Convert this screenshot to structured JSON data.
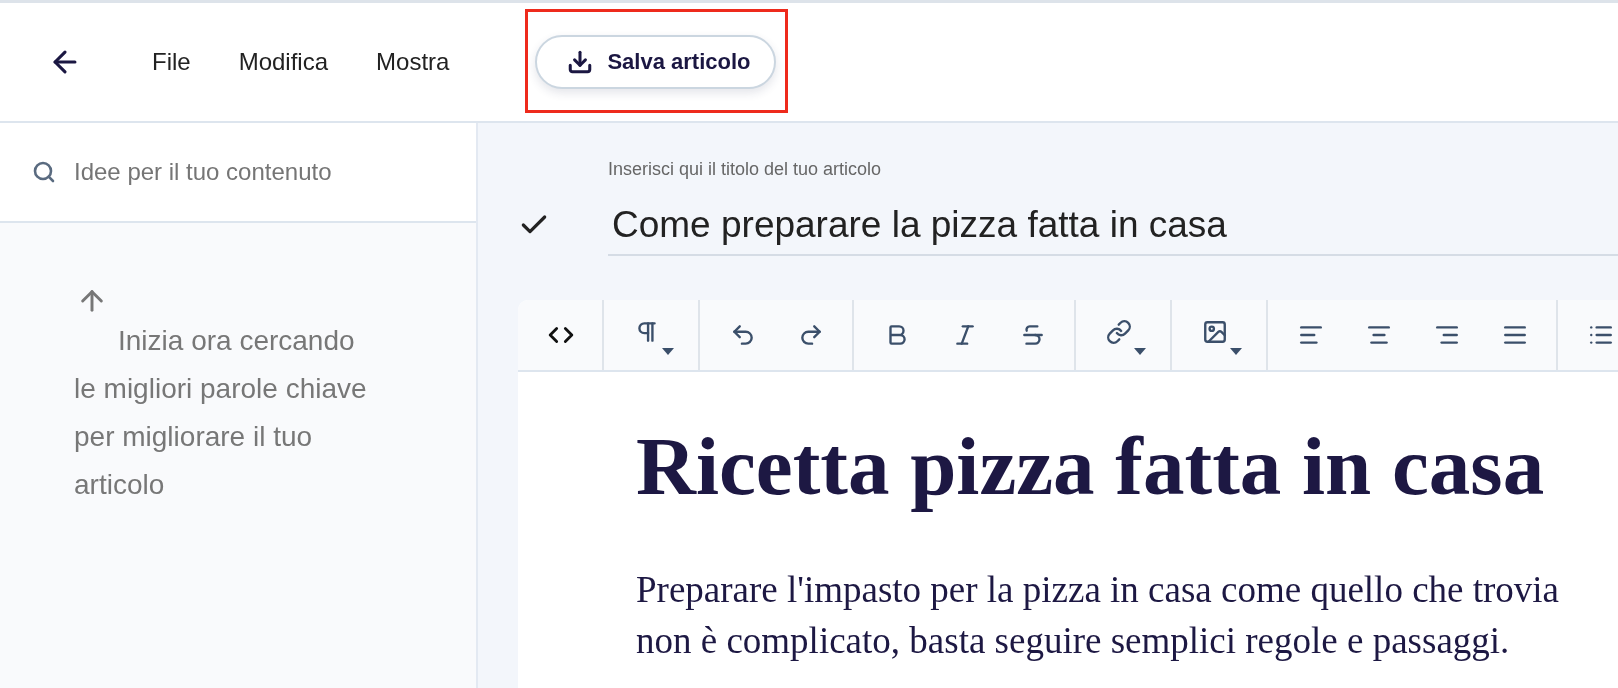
{
  "menu": [
    {
      "label": "File"
    },
    {
      "label": "Modifica"
    },
    {
      "label": "Mostra"
    }
  ],
  "save_button": {
    "label": "Salva articolo",
    "highlighted": true
  },
  "sidebar": {
    "search": {
      "placeholder": "Idee per il tuo contenuto"
    },
    "hint": "Inizia ora cercando le migliori parole chiave per migliorare il tuo articolo"
  },
  "title_field": {
    "label": "Inserisci qui il titolo del tuo articolo",
    "value": "Come preparare la pizza fatta in casa",
    "confirmed": true
  },
  "toolbar": [
    [
      {
        "kind": "code",
        "menu": false
      }
    ],
    [
      {
        "kind": "paragraph",
        "menu": true
      }
    ],
    [
      {
        "kind": "undo",
        "menu": false
      },
      {
        "kind": "redo",
        "menu": false
      }
    ],
    [
      {
        "kind": "bold",
        "menu": false
      },
      {
        "kind": "italic",
        "menu": false
      },
      {
        "kind": "strike",
        "menu": false
      }
    ],
    [
      {
        "kind": "link",
        "menu": true
      }
    ],
    [
      {
        "kind": "image",
        "menu": true
      }
    ],
    [
      {
        "kind": "align-left",
        "menu": false
      },
      {
        "kind": "align-center",
        "menu": false
      },
      {
        "kind": "align-right",
        "menu": false
      },
      {
        "kind": "align-justify",
        "menu": false
      }
    ],
    [
      {
        "kind": "list",
        "menu": false
      }
    ]
  ],
  "document": {
    "heading": "Ricetta pizza fatta in casa",
    "paragraph_lines": [
      "Preparare l'impasto per la pizza in casa come quello che trovia",
      "non è complicato, basta seguire semplici regole e passaggi."
    ]
  }
}
